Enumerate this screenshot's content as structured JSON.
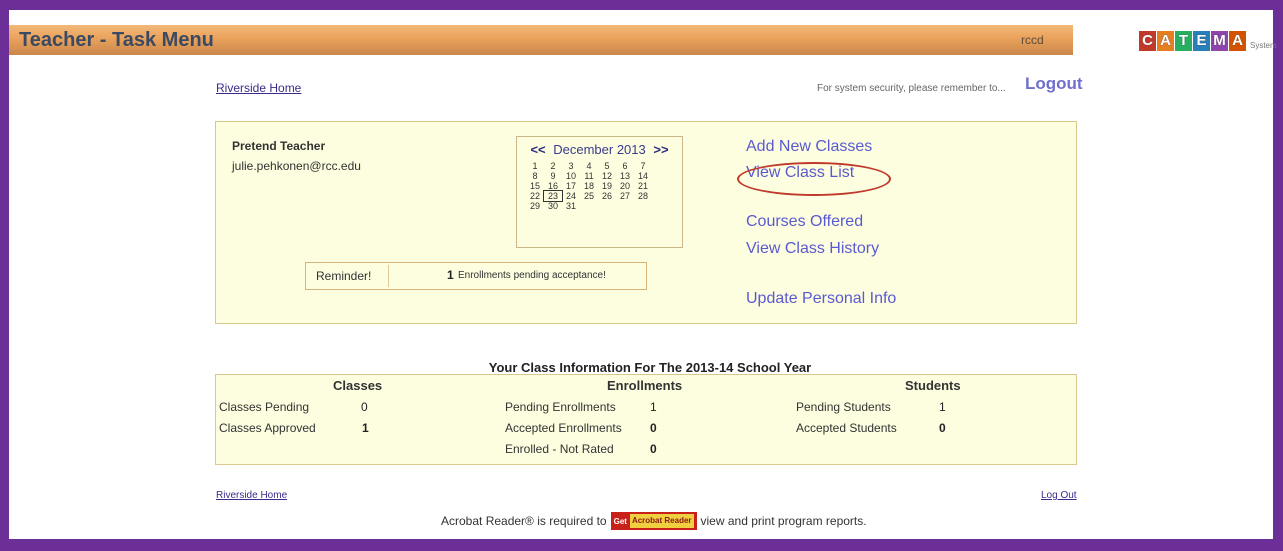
{
  "header": {
    "title": "Teacher - Task Menu",
    "user": "rccd",
    "logo_text": "CATEMA",
    "logo_sub": "System"
  },
  "top": {
    "home_link": "Riverside Home",
    "security_msg": "For system security, please remember to...",
    "logout": "Logout"
  },
  "teacher": {
    "name": "Pretend Teacher",
    "email": "julie.pehkonen@rcc.edu"
  },
  "calendar": {
    "prev": "<<",
    "next": ">>",
    "month_label": "December 2013",
    "days": [
      "1",
      "2",
      "3",
      "4",
      "5",
      "6",
      "7",
      "8",
      "9",
      "10",
      "11",
      "12",
      "13",
      "14",
      "15",
      "16",
      "17",
      "18",
      "19",
      "20",
      "21",
      "22",
      "23",
      "24",
      "25",
      "26",
      "27",
      "28",
      "29",
      "30",
      "31"
    ],
    "today": "23"
  },
  "reminder": {
    "label": "Reminder!",
    "count": "1",
    "message": "Enrollments pending acceptance!"
  },
  "menu": {
    "add_new_classes": "Add New Classes",
    "view_class_list": "View Class List",
    "courses_offered": "Courses Offered",
    "view_class_history": "View Class History",
    "update_personal_info": "Update Personal Info"
  },
  "info": {
    "title": "Your Class Information For The 2013-14 School Year",
    "classes": {
      "header": "Classes",
      "pending_label": "Classes Pending",
      "pending_value": "0",
      "approved_label": "Classes Approved",
      "approved_value": "1"
    },
    "enrollments": {
      "header": "Enrollments",
      "pending_label": "Pending Enrollments",
      "pending_value": "1",
      "accepted_label": "Accepted Enrollments",
      "accepted_value": "0",
      "not_rated_label": "Enrolled - Not Rated",
      "not_rated_value": "0"
    },
    "students": {
      "header": "Students",
      "pending_label": "Pending Students",
      "pending_value": "1",
      "accepted_label": "Accepted Students",
      "accepted_value": "0"
    }
  },
  "footer": {
    "home_link": "Riverside Home",
    "logout_link": "Log Out",
    "acrobat_before": "Acrobat Reader® is required to",
    "acrobat_badge_a": "Get",
    "acrobat_badge_b": "Acrobat Reader",
    "acrobat_after": "view and print program reports."
  },
  "colors": {
    "border": "#6b2f97",
    "titlebar": "#e9a25c",
    "panel": "#fdfde0",
    "link": "#5a5ad0",
    "highlight_circle": "#c0392b"
  }
}
